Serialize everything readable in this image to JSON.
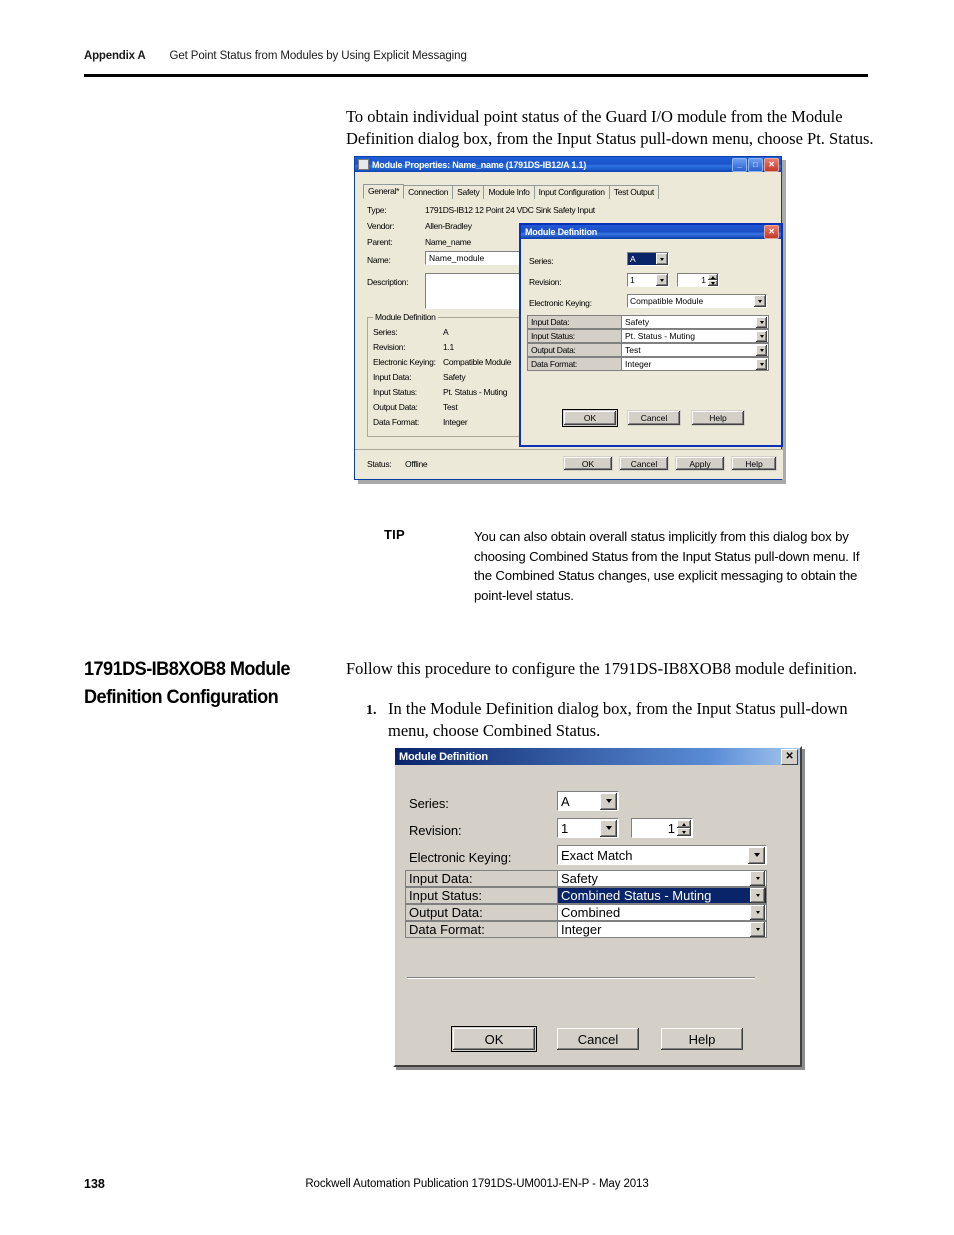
{
  "header": {
    "appendix": "Appendix A",
    "title": "Get Point Status from Modules by Using Explicit Messaging"
  },
  "intro_paragraph": "To obtain individual point status of the Guard I/O module from the Module Definition dialog box, from the Input Status pull-down menu, choose Pt. Status.",
  "tip": {
    "label": "TIP",
    "text": "You can also obtain overall status implicitly from this dialog box by choosing Combined Status from the Input Status pull-down menu. If the Combined Status changes, use explicit messaging to obtain the point-level status."
  },
  "section": {
    "heading_line1": "1791DS-IB8XOB8 Module",
    "heading_line2": "Definition Configuration",
    "intro": "Follow this procedure to configure the 1791DS-IB8XOB8 module definition.",
    "step_number": "1.",
    "step_text": "In the Module Definition dialog box, from the Input Status pull-down menu, choose Combined Status."
  },
  "figure1": {
    "window": {
      "title": "Module Properties: Name_name (1791DS-IB12/A 1.1)",
      "minimize": "_",
      "maximize": "□",
      "close": "✕"
    },
    "tabs": [
      {
        "label": "General*",
        "active": true
      },
      {
        "label": "Connection",
        "active": false
      },
      {
        "label": "Safety",
        "active": false
      },
      {
        "label": "Module Info",
        "active": false
      },
      {
        "label": "Input Configuration",
        "active": false
      },
      {
        "label": "Test Output",
        "active": false
      }
    ],
    "fields": [
      {
        "label": "Type:",
        "value": "1791DS-IB12 12 Point 24 VDC Sink Safety Input"
      },
      {
        "label": "Vendor:",
        "value": "Allen-Bradley"
      },
      {
        "label": "Parent:",
        "value": "Name_name"
      }
    ],
    "name_label": "Name:",
    "name_value": "Name_module",
    "description_label": "Description:",
    "description_value": "",
    "group_caption": "Module Definition",
    "group_rows": [
      {
        "label": "Series:",
        "value": "A"
      },
      {
        "label": "Revision:",
        "value": "1.1"
      },
      {
        "label": "Electronic Keying:",
        "value": "Compatible Module"
      },
      {
        "label": "Input Data:",
        "value": "Safety"
      },
      {
        "label": "Input Status:",
        "value": "Pt. Status - Muting"
      },
      {
        "label": "Output Data:",
        "value": "Test"
      },
      {
        "label": "Data Format:",
        "value": "Integer"
      }
    ],
    "status_label": "Status:",
    "status_value": "Offline",
    "buttons": [
      "OK",
      "Cancel",
      "Apply",
      "Help"
    ],
    "modal": {
      "title": "Module Definition",
      "close": "✕",
      "series_label": "Series:",
      "series_value": "A",
      "revision_label": "Revision:",
      "revision_major": "1",
      "revision_minor": "1",
      "keying_label": "Electronic Keying:",
      "keying_value": "Compatible Module",
      "rows": [
        {
          "label": "Input Data:",
          "value": "Safety",
          "selected": false
        },
        {
          "label": "Input Status:",
          "value": "Pt. Status - Muting",
          "selected": false
        },
        {
          "label": "Output Data:",
          "value": "Test",
          "selected": false
        },
        {
          "label": "Data Format:",
          "value": "Integer",
          "selected": false
        }
      ],
      "buttons": [
        "OK",
        "Cancel",
        "Help"
      ]
    }
  },
  "figure2": {
    "title": "Module Definition",
    "close": "✕",
    "series_label": "Series:",
    "series_value": "A",
    "revision_label": "Revision:",
    "revision_major": "1",
    "revision_minor": "1",
    "keying_label": "Electronic Keying:",
    "keying_value": "Exact Match",
    "rows": [
      {
        "label": "Input Data:",
        "value": "Safety",
        "selected": false
      },
      {
        "label": "Input Status:",
        "value": "Combined Status - Muting",
        "selected": true
      },
      {
        "label": "Output Data:",
        "value": "Combined",
        "selected": false
      },
      {
        "label": "Data Format:",
        "value": "Integer",
        "selected": false
      }
    ],
    "buttons": [
      "OK",
      "Cancel",
      "Help"
    ]
  },
  "footer": {
    "page_number": "138",
    "publication": "Rockwell Automation Publication 1791DS-UM001J-EN-P - May 2013"
  },
  "colors": {
    "dialog_face": "#d4d0c8",
    "xp_face": "#ece9d8",
    "title_blue": "#0a246a",
    "selection_navy": "#0a246a"
  }
}
